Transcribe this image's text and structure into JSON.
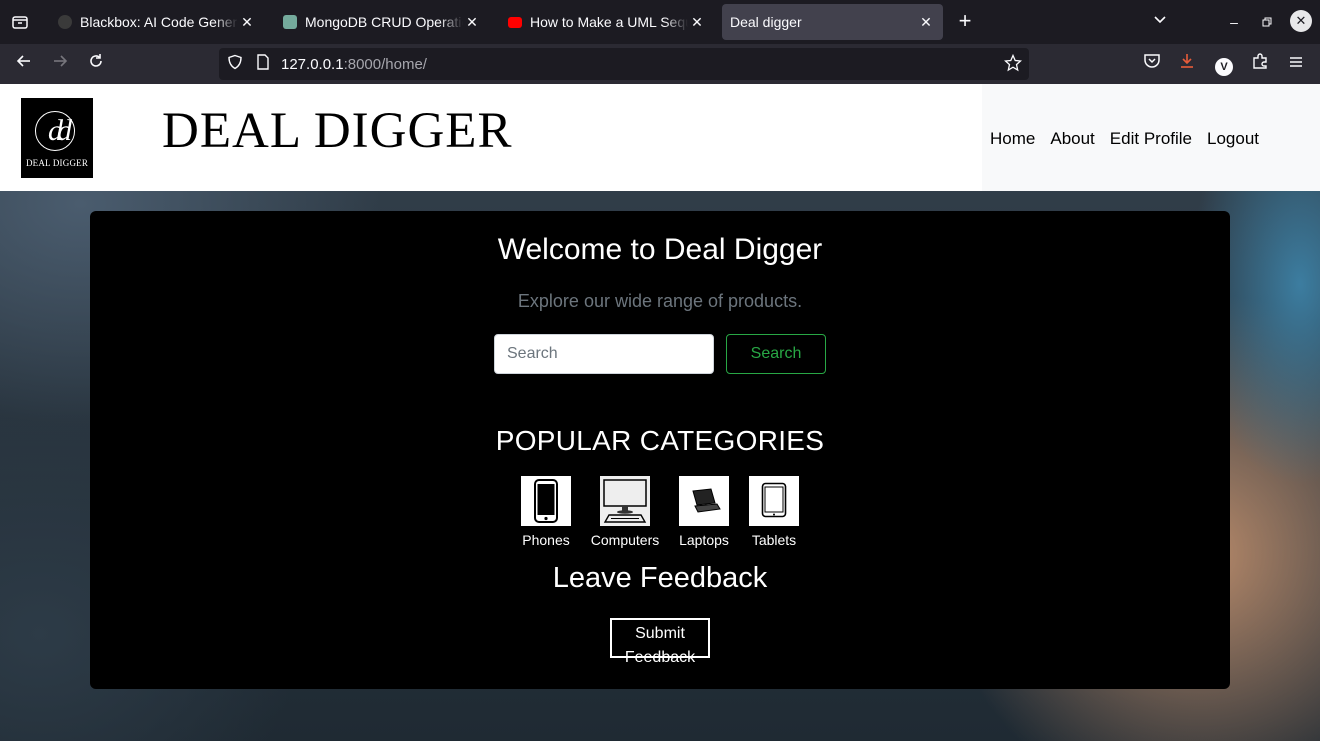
{
  "browser": {
    "tabs": [
      {
        "title": "Blackbox: AI Code Generation, Code Chat, Code Search",
        "favicon_color": "#3a3a3a",
        "active": false
      },
      {
        "title": "MongoDB CRUD Operations",
        "favicon_color": "#74aa9c",
        "active": false
      },
      {
        "title": "How to Make a UML Sequence Diagram",
        "favicon_color": "#ff0000",
        "active": false
      },
      {
        "title": "Deal digger",
        "favicon_color": "",
        "active": true
      }
    ],
    "url_host": "127.0.0.1",
    "url_rest": ":8000/home/",
    "icons": [
      "tab-list-icon",
      "back-icon",
      "forward-icon",
      "reload-icon",
      "shield-icon",
      "page-icon",
      "star-icon",
      "pocket-icon",
      "download-icon",
      "profile-icon",
      "extensions-icon",
      "menu-icon"
    ],
    "profile_letter": "V"
  },
  "header": {
    "logo_monogram": "d",
    "logo_text": "DEAL DIGGER",
    "site_title": "DEAL DIGGER",
    "menu": [
      "Home",
      "About",
      "Edit Profile",
      "Logout"
    ]
  },
  "main": {
    "welcome": "Welcome to Deal Digger",
    "tagline": "Explore our wide range of products.",
    "search_placeholder": "Search",
    "search_button": "Search",
    "categories_title": "POPULAR CATEGORIES",
    "categories": [
      {
        "label": "Phones",
        "icon": "phone-icon"
      },
      {
        "label": "Computers",
        "icon": "computer-icon"
      },
      {
        "label": "Laptops",
        "icon": "laptop-icon"
      },
      {
        "label": "Tablets",
        "icon": "tablet-icon"
      }
    ],
    "feedback_title": "Leave Feedback",
    "feedback_button": "Submit Feedback"
  },
  "colors": {
    "accent_green": "#28a745",
    "card_bg": "#000000",
    "muted": "#6c757d"
  }
}
